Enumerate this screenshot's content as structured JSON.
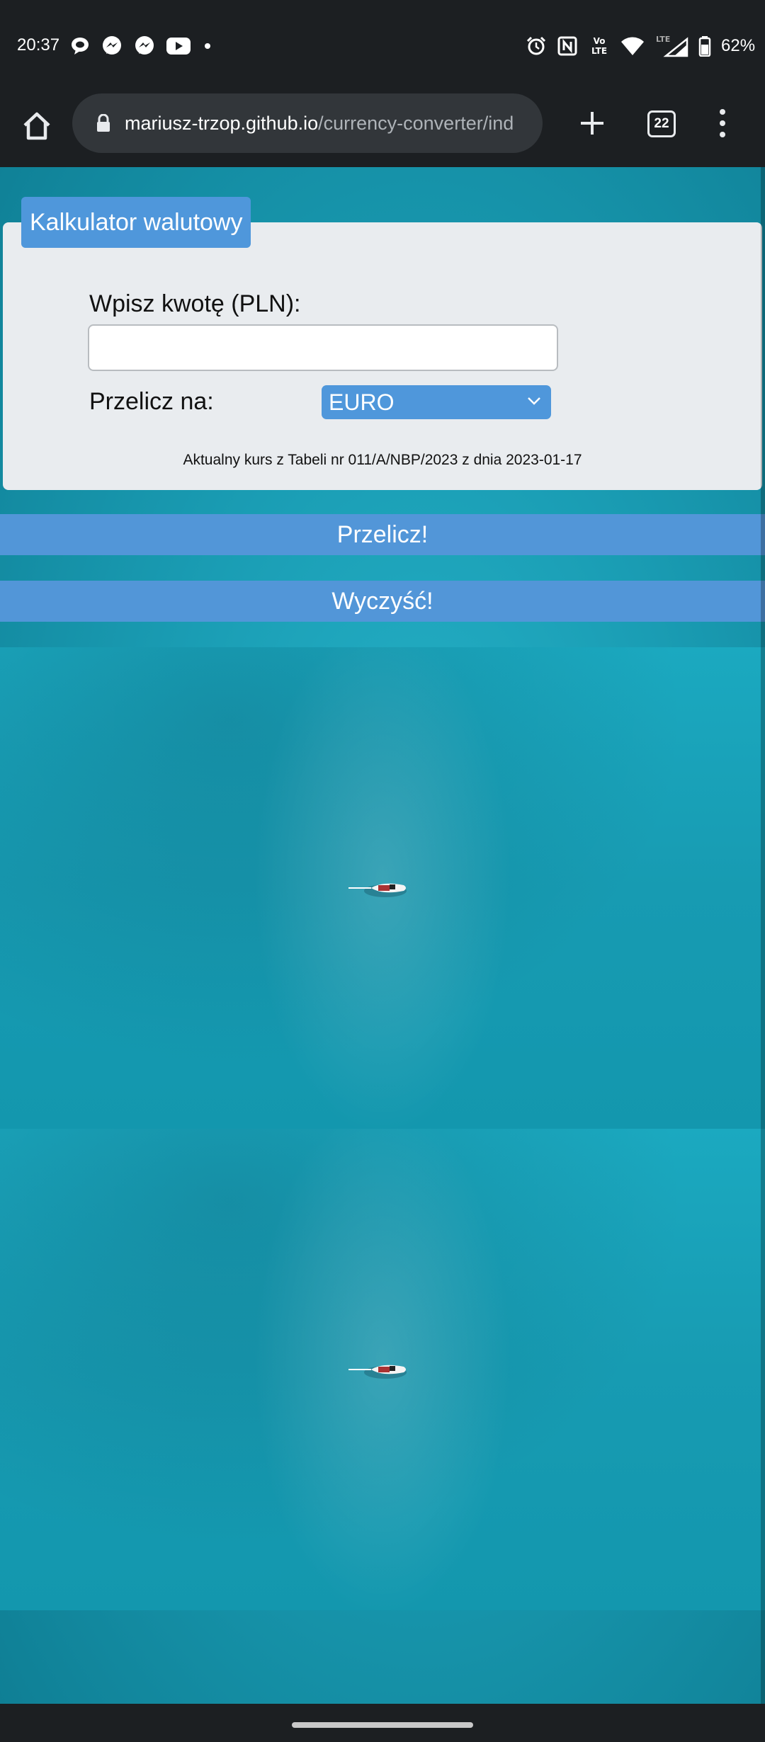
{
  "status_bar": {
    "time": "20:37",
    "battery": "62%",
    "left_icons": [
      "chat-bubble-icon",
      "messenger-icon",
      "messenger-icon",
      "youtube-icon",
      "dot-icon"
    ],
    "right_icons": [
      "alarm-icon",
      "nfc-icon",
      "volte-icon",
      "wifi-icon",
      "lte-signal-icon",
      "battery-icon"
    ],
    "volte_label": "Vo LTE",
    "lte_label": "LTE"
  },
  "browser": {
    "url_host": "mariusz-trzop.github.io",
    "url_path": "/currency-converter/ind",
    "tab_count": "22"
  },
  "converter": {
    "title": "Kalkulator walutowy",
    "amount_label": "Wpisz kwotę (PLN):",
    "amount_value": "",
    "convert_label": "Przelicz na:",
    "currency_selected": "EURO",
    "rate_note": "Aktualny kurs z Tabeli nr 011/A/NBP/2023 z dnia 2023-01-17",
    "convert_button": "Przelicz!",
    "clear_button": "Wyczyść!"
  },
  "colors": {
    "accent": "#4f97db",
    "card_bg": "#e9ecef",
    "system_bar": "#1c1f22",
    "water": "#1ba9c0"
  }
}
